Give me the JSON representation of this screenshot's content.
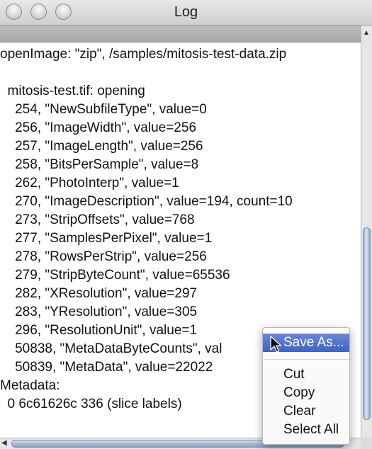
{
  "window": {
    "title": "Log"
  },
  "log": {
    "lines": [
      "openImage: \"zip\", /samples/mitosis-test-data.zip",
      "",
      "  mitosis-test.tif: opening",
      "    254, \"NewSubfileType\", value=0",
      "    256, \"ImageWidth\", value=256",
      "    257, \"ImageLength\", value=256",
      "    258, \"BitsPerSample\", value=8",
      "    262, \"PhotoInterp\", value=1",
      "    270, \"ImageDescription\", value=194, count=10",
      "    273, \"StripOffsets\", value=768",
      "    277, \"SamplesPerPixel\", value=1",
      "    278, \"RowsPerStrip\", value=256",
      "    279, \"StripByteCount\", value=65536",
      "    282, \"XResolution\", value=297",
      "    283, \"YResolution\", value=305",
      "    296, \"ResolutionUnit\", value=1",
      "    50838, \"MetaDataByteCounts\", val",
      "    50839, \"MetaData\", value=22022",
      "Metadata:",
      "  0 6c61626c 336 (slice labels)"
    ]
  },
  "context_menu": {
    "save_as": "Save As...",
    "cut": "Cut",
    "copy": "Copy",
    "clear": "Clear",
    "select_all": "Select All"
  },
  "icons": {
    "cursor": "arrow-cursor-icon",
    "scroll_up": "scroll-up-arrow-icon",
    "scroll_left": "scroll-left-arrow-icon"
  },
  "colors": {
    "menu_highlight": "#3d63c7",
    "scroll_thumb": "#9fb3cc"
  }
}
